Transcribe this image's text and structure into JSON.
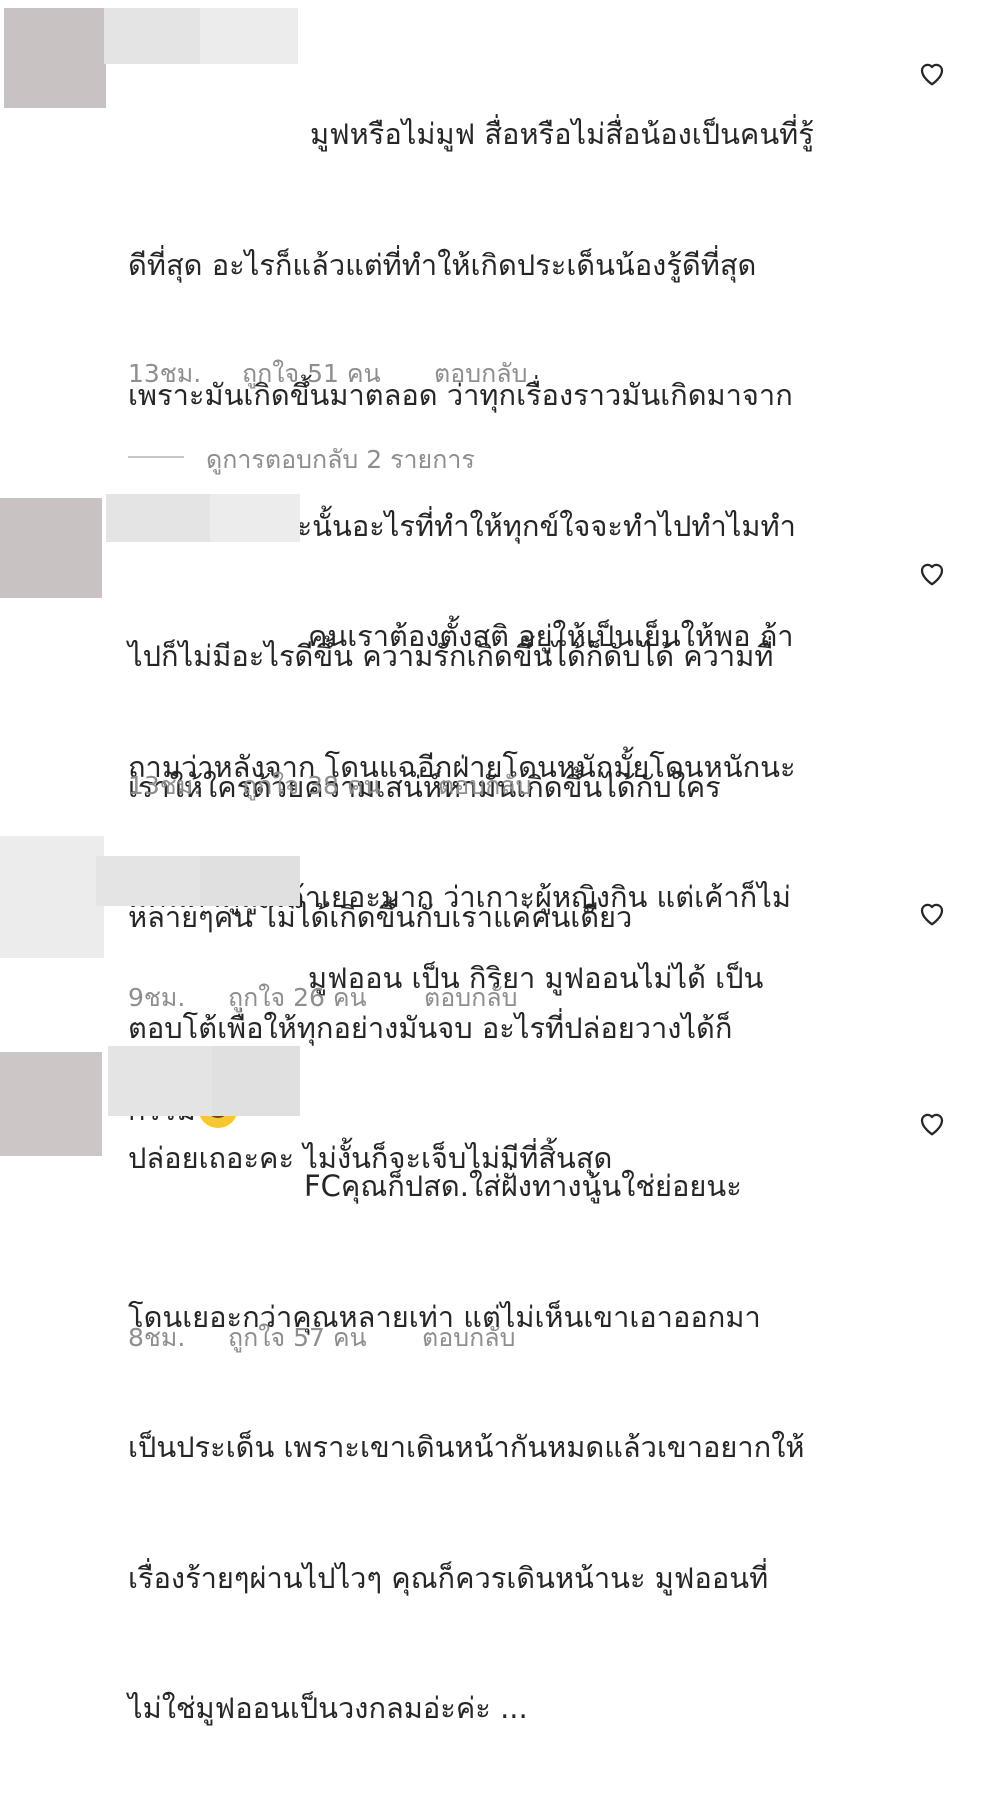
{
  "comments": [
    {
      "lines": [
        "มูฟหรือไม่มูฟ สื่อหรือไม่สื่อน้องเป็นคนที่รู้",
        "ดีที่สุด อะไรก็แล้วแต่ที่ทำให้เกิดประเด็นน้องรู้ดีที่สุด",
        "เพราะมันเกิดขึ้นมาตลอด ว่าทุกเรื่องราวมันเกิดมาจาก",
        "อะไร เพราะฉะนั้นอะไรที่ทำให้ทุกข์ใจจะทำไปทำไมทำ",
        "ไปก็ไม่มีอะไรดีขึ้น ความรักเกิดขึ้นได้ก็ดับได้ ความที่",
        "เราให้ใครด้วยความเสน่ห์หามันเกิดขึ้นได้กับใคร",
        "หลายๆคน ไม่ได้เกิดขึ้นกับเราแค่คนเดียว"
      ],
      "time": "13ชม.",
      "likes": "ถูกใจ 51 คน",
      "reply_label": "ตอบกลับ",
      "like_icon": "heart-outline-icon"
    },
    {
      "lines": [
        "คนเราต้องตั้งสติ อยู่ให้เป็นเย็นให้พอ ถ้า",
        "ถามว่าหลังจาก โดนแฉอีกฝ่ายโดนหนักมั้ยโดนหนักนะ",
        "มีคนด่าดูถูกเค้าเยอะมาก ว่าเกาะผู้หญิงกิน แต่เค้าก็ไม่",
        "ตอบโต้เพื่อให้ทุกอย่างมันจบ อะไรที่ปล่อยวางได้ก็",
        "ปล่อยเถอะคะ ไม่งั้นก็จะเจ็บไม่มีที่สิ้นสุด"
      ],
      "time": "13ชม.",
      "likes": "ถูกใจ 38 คน",
      "reply_label": "ตอบกลับ",
      "like_icon": "heart-outline-icon"
    },
    {
      "lines": [
        "มูฟออน เป็น กิริยา มูฟออนไม่ได้ เป็น",
        "กรรม"
      ],
      "emoji": "tears-of-joy-emoji",
      "time": "9ชม.",
      "likes": "ถูกใจ 26 คน",
      "reply_label": "ตอบกลับ",
      "like_icon": "heart-outline-icon"
    },
    {
      "lines": [
        "FCคุณก็ปสด.ใส่ฝั่งทางนู้นใช่ย่อยนะ",
        "โดนเยอะกว่าคุณหลายเท่า แต่ไม่เห็นเขาเอาออกมา",
        "เป็นประเด็น เพราะเขาเดินหน้ากันหมดแล้วเขาอยากให้",
        "เรื่องร้ายๆผ่านไปไวๆ คุณก็ควรเดินหน้านะ มูฟออนที่",
        "ไม่ใช่มูฟออนเป็นวงกลมอ่ะค่ะ ..."
      ],
      "time": "8ชม.",
      "likes": "ถูกใจ 57 คน",
      "reply_label": "ตอบกลับ",
      "like_icon": "heart-outline-icon"
    }
  ],
  "view_replies": "ดูการตอบกลับ 2 รายการ",
  "colors": {
    "text": "#262626",
    "meta": "#8e8e8e",
    "avatar_redacted": "#c8c2c2",
    "username_redacted": "#e4e4e4"
  }
}
